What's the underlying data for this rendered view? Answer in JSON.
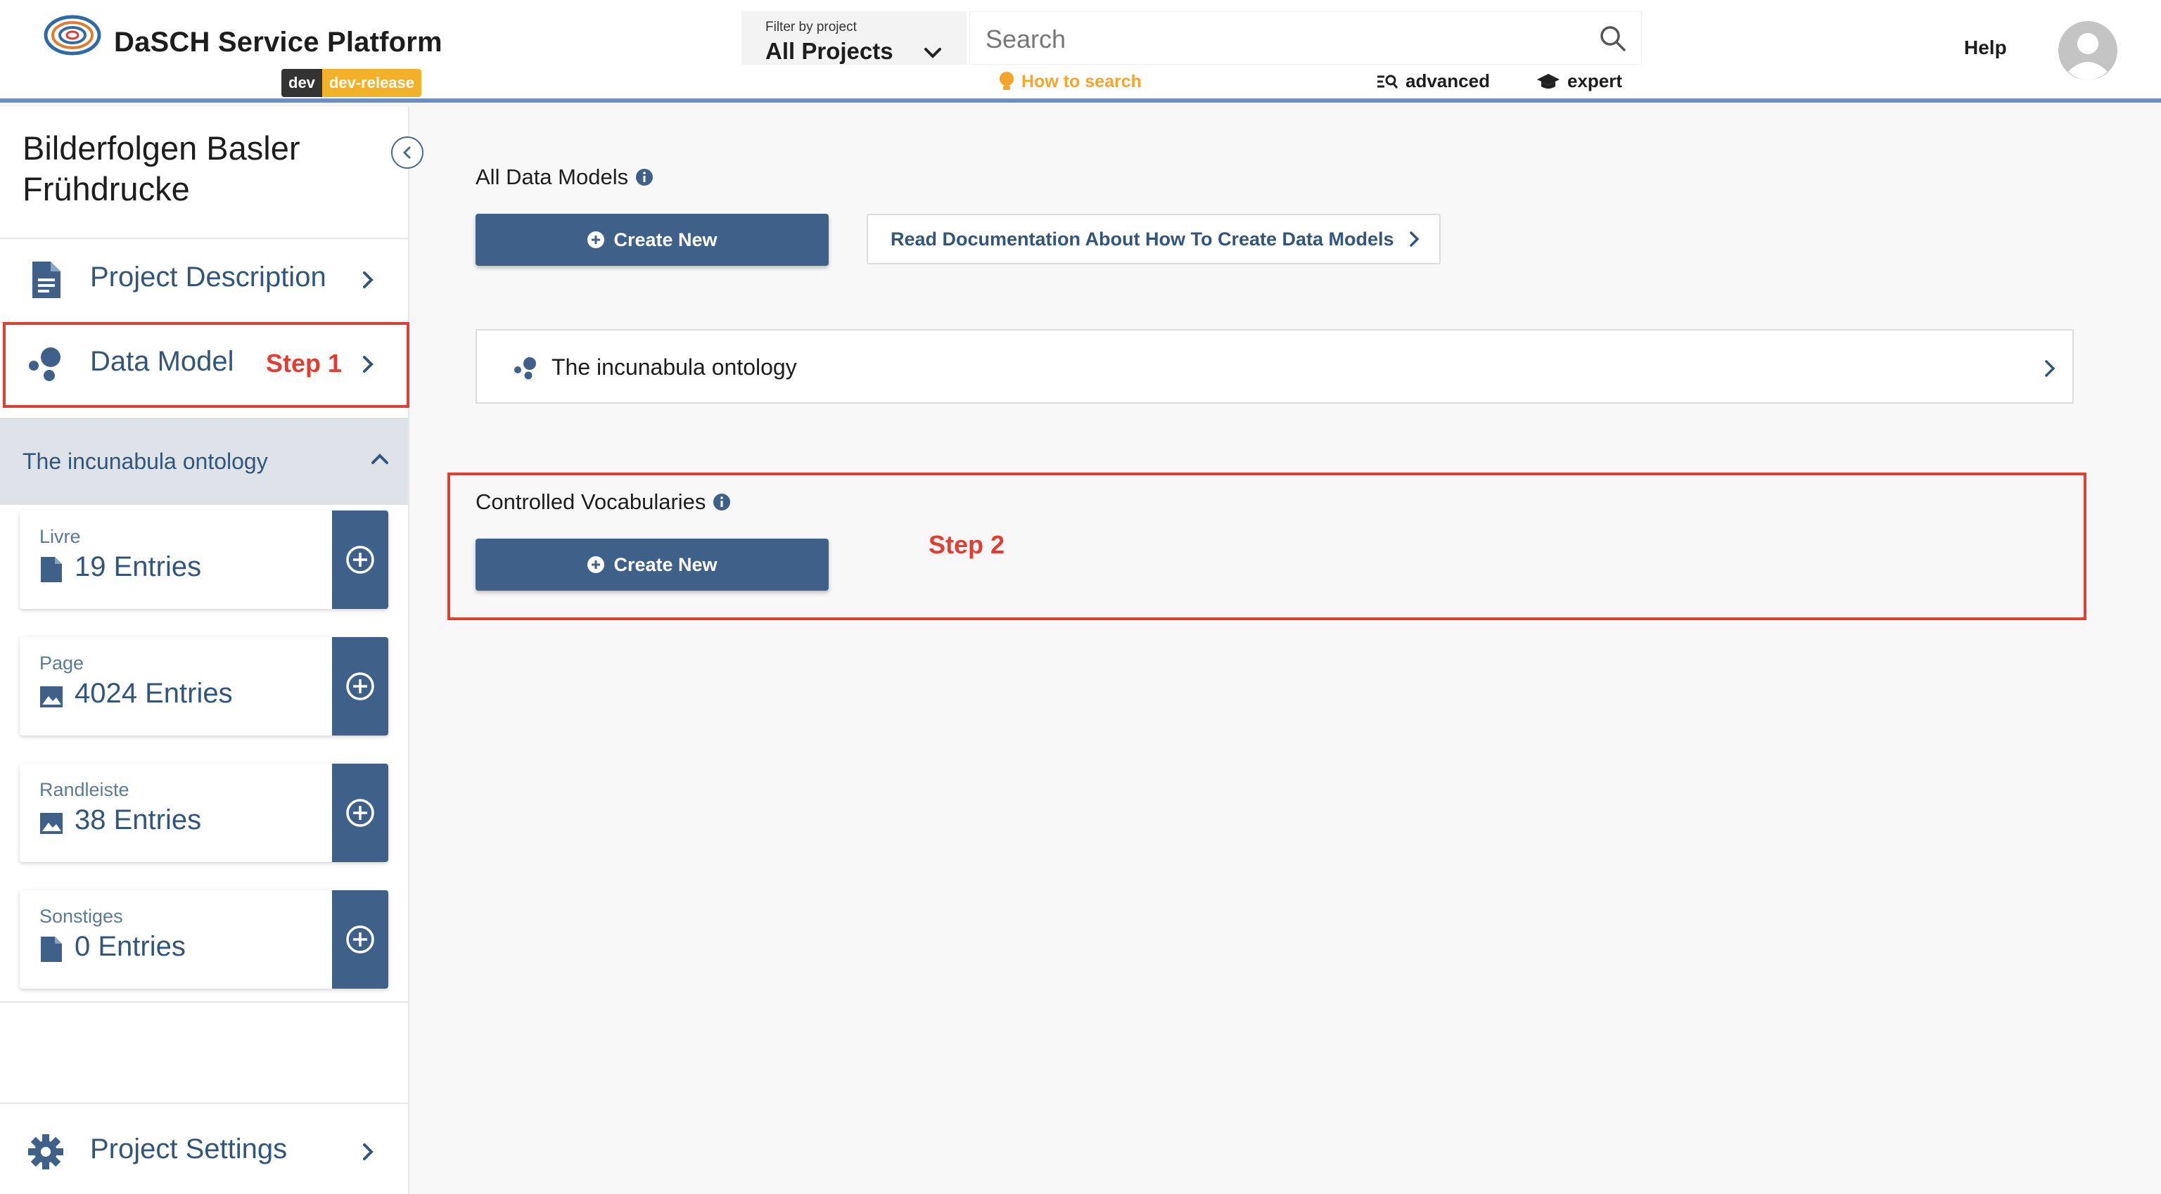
{
  "header": {
    "app_title": "DaSCH Service Platform",
    "env_badge_dev": "dev",
    "env_badge_release": "dev-release",
    "filter_label": "Filter by project",
    "filter_value": "All Projects",
    "search_placeholder": "Search",
    "how_to_search": "How to search",
    "advanced_label": "advanced",
    "expert_label": "expert",
    "help_label": "Help"
  },
  "sidebar": {
    "project_title": "Bilderfolgen Basler Frühdrucke",
    "nav": {
      "project_description": "Project Description",
      "data_model": "Data Model",
      "project_settings": "Project Settings"
    },
    "step1_label": "Step 1",
    "ontology_label": "The incunabula ontology",
    "resources": [
      {
        "name": "Livre",
        "count": "19 Entries",
        "icon": "document-icon"
      },
      {
        "name": "Page",
        "count": "4024 Entries",
        "icon": "image-icon"
      },
      {
        "name": "Randleiste",
        "count": "38 Entries",
        "icon": "image-icon"
      },
      {
        "name": "Sonstiges",
        "count": "0 Entries",
        "icon": "document-icon"
      }
    ]
  },
  "main": {
    "all_data_models_title": "All Data Models",
    "create_new_label": "Create New",
    "read_docs_label": "Read Documentation About How To Create Data Models",
    "ontology_card_label": "The incunabula ontology",
    "controlled_vocab_title": "Controlled Vocabularies",
    "create_new_vocab_label": "Create New",
    "step2_label": "Step 2"
  },
  "colors": {
    "primary": "#3f6189",
    "accent_orange": "#f3a52c",
    "annotation_red": "#e03e33",
    "header_line": "#6b8fc2"
  }
}
